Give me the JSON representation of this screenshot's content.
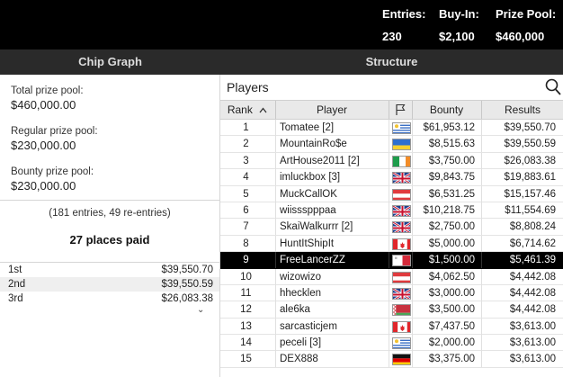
{
  "header": {
    "entries_label": "Entries:",
    "entries_value": "230",
    "buyin_label": "Buy-In:",
    "buyin_value": "$2,100",
    "prizepool_label": "Prize Pool:",
    "prizepool_value": "$460,000"
  },
  "tabs": {
    "chip_graph": "Chip Graph",
    "structure": "Structure"
  },
  "summary": {
    "total_label": "Total prize pool:",
    "total_value": "$460,000.00",
    "regular_label": "Regular prize pool:",
    "regular_value": "$230,000.00",
    "bounty_label": "Bounty prize pool:",
    "bounty_value": "$230,000.00",
    "entries_note": "(181 entries, 49 re-entries)",
    "places_paid": "27 places paid"
  },
  "payouts": [
    {
      "place": "1st",
      "amount": "$39,550.70"
    },
    {
      "place": "2nd",
      "amount": "$39,550.59"
    },
    {
      "place": "3rd",
      "amount": "$26,083.38"
    }
  ],
  "players_panel": {
    "title": "Players",
    "columns": {
      "rank": "Rank",
      "player": "Player",
      "bounty": "Bounty",
      "results": "Results"
    },
    "rows": [
      {
        "rank": "1",
        "player": "Tomatee [2]",
        "flag": "uruguay",
        "bounty": "$61,953.12",
        "results": "$39,550.70"
      },
      {
        "rank": "2",
        "player": "MountainRo$e",
        "flag": "ukraine",
        "bounty": "$8,515.63",
        "results": "$39,550.59"
      },
      {
        "rank": "3",
        "player": "ArtHouse2011 [2]",
        "flag": "ireland",
        "bounty": "$3,750.00",
        "results": "$26,083.38"
      },
      {
        "rank": "4",
        "player": "imluckbox [3]",
        "flag": "uk",
        "bounty": "$9,843.75",
        "results": "$19,883.61"
      },
      {
        "rank": "5",
        "player": "MuckCallOK",
        "flag": "austria",
        "bounty": "$6,531.25",
        "results": "$15,157.46"
      },
      {
        "rank": "6",
        "player": "wiissspppaa",
        "flag": "uk",
        "bounty": "$10,218.75",
        "results": "$11,554.69"
      },
      {
        "rank": "7",
        "player": "SkaiWalkurrr [2]",
        "flag": "uk",
        "bounty": "$2,750.00",
        "results": "$8,808.24"
      },
      {
        "rank": "8",
        "player": "HuntItShipIt",
        "flag": "canada",
        "bounty": "$5,000.00",
        "results": "$6,714.62"
      },
      {
        "rank": "9",
        "player": "FreeLancerZZ",
        "flag": "malta",
        "bounty": "$1,500.00",
        "results": "$5,461.39",
        "highlight": true
      },
      {
        "rank": "10",
        "player": "wizowizo",
        "flag": "austria",
        "bounty": "$4,062.50",
        "results": "$4,442.08"
      },
      {
        "rank": "11",
        "player": "hhecklen",
        "flag": "uk",
        "bounty": "$3,000.00",
        "results": "$4,442.08"
      },
      {
        "rank": "12",
        "player": "ale6ka",
        "flag": "belarus",
        "bounty": "$3,500.00",
        "results": "$4,442.08"
      },
      {
        "rank": "13",
        "player": "sarcasticjem",
        "flag": "canada",
        "bounty": "$7,437.50",
        "results": "$3,613.00"
      },
      {
        "rank": "14",
        "player": "peceli [3]",
        "flag": "uruguay",
        "bounty": "$2,000.00",
        "results": "$3,613.00"
      },
      {
        "rank": "15",
        "player": "DEX888",
        "flag": "germany",
        "bounty": "$3,375.00",
        "results": "$3,613.00"
      }
    ]
  },
  "icons": {
    "search": "search-icon",
    "sort": "sort-ascending-icon",
    "flag_column": "flag-icon",
    "collapse": "chevron-down-icon"
  },
  "colors": {
    "topbar_bg": "#000000",
    "tabbar_bg": "#2a2a2a",
    "highlight_row_bg": "#000000",
    "header_row_bg": "#e9e9e9"
  }
}
